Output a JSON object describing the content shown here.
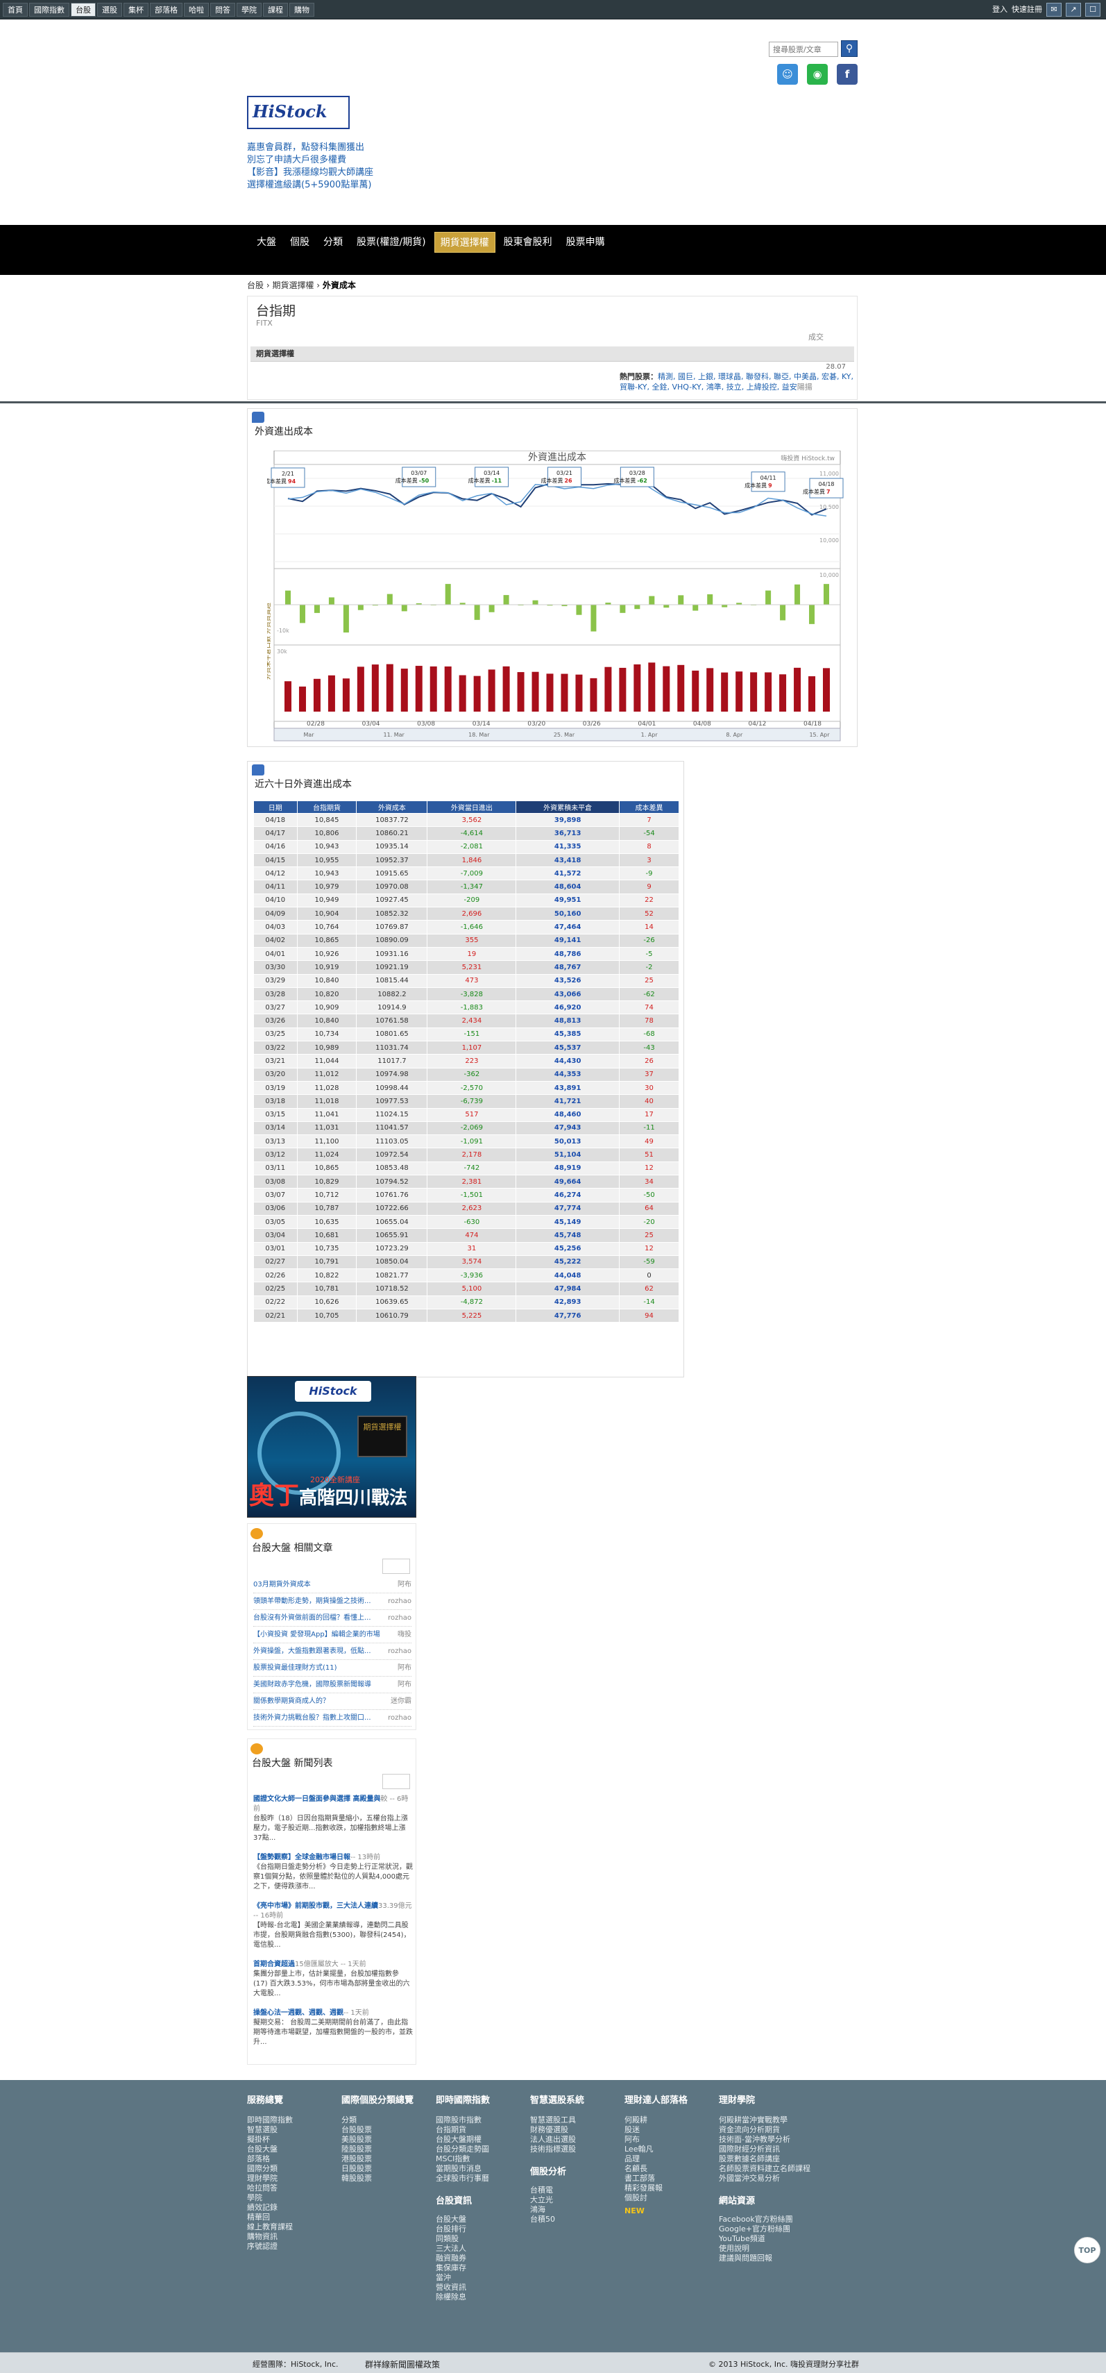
{
  "topbar": {
    "nav": [
      "首頁",
      "國際指數",
      "台股",
      "選股",
      "集杯",
      "部落格",
      "哈啦",
      "問答",
      "學院",
      "課程",
      "購物"
    ],
    "active_index": 2,
    "login": "登入",
    "register": "快速註冊"
  },
  "header": {
    "search_placeholder": "搜尋股票/文章",
    "promo": [
      "嘉惠會員群，點發科集團獲出",
      "別忘了申請大戶很多權費",
      "【影音】我漲穩線均觀大師講座",
      "選擇權進級講(5+5900點單萬)"
    ]
  },
  "mainnav": {
    "items": [
      "大盤",
      "個股",
      "分類",
      "股票(權證/期貨)",
      "期貨選擇權",
      "股東會股利",
      "股票申購"
    ],
    "active_index": 4
  },
  "breadcrumb": {
    "a": "台股",
    "b": "期貨選擇權",
    "c": "外資成本"
  },
  "stock": {
    "name": "台指期",
    "code": "FITX",
    "volume_label": "成交",
    "fund_bar": "期貨選擇權",
    "date": "28.07",
    "hot_label": "熱門股票：",
    "hot_items": "精測, 國巨, 上銀, 環球晶, 聯發科, 聯亞, 中美晶, 宏碁, KY, 貿聯-KY, 全銓, VHQ-KY, 鴻準, 技立, 上緯投控, 益安",
    "hot_tail": "陽揚"
  },
  "chart_panel": {
    "title": "外資進出成本",
    "chart_title": "外資進出成本",
    "watermark": "嗨投資 HiStock.tw",
    "top_ticks": [
      "11,000",
      "10,500",
      "10,000"
    ],
    "mid_ticks": [
      "10,000",
      "-10k"
    ],
    "bottom_tick": "30k",
    "ylabel_left": "外資未平倉口數 外資買賣超",
    "x_labels": [
      "02/28",
      "03/04",
      "03/08",
      "03/14",
      "03/20",
      "03/26",
      "04/01",
      "04/08",
      "04/12",
      "04/18"
    ],
    "nav_labels": [
      "Mar",
      "11. Mar",
      "18. Mar",
      "25. Mar",
      "1. Apr",
      "8. Apr",
      "15. Apr"
    ],
    "annotations": [
      {
        "date": "2/21",
        "label": "成本差異",
        "value": "94",
        "color": "#d32020"
      },
      {
        "date": "03/07",
        "label": "成本差異",
        "value": "-50",
        "color": "#1a8a1a"
      },
      {
        "date": "03/14",
        "label": "成本差異",
        "value": "-11",
        "color": "#1a8a1a"
      },
      {
        "date": "03/21",
        "label": "成本差異",
        "value": "26",
        "color": "#d32020"
      },
      {
        "date": "03/28",
        "label": "成本差異",
        "value": "-62",
        "color": "#1a8a1a"
      },
      {
        "date": "04/11",
        "label": "成本差異",
        "value": "9",
        "color": "#d32020"
      },
      {
        "date": "04/18",
        "label": "成本差異",
        "value": "7",
        "color": "#d32020"
      }
    ]
  },
  "chart_data": {
    "type": "line",
    "title": "外資進出成本",
    "x": [
      "02/21",
      "02/22",
      "02/25",
      "02/26",
      "02/27",
      "03/01",
      "03/04",
      "03/05",
      "03/06",
      "03/07",
      "03/08",
      "03/11",
      "03/12",
      "03/13",
      "03/14",
      "03/15",
      "03/18",
      "03/19",
      "03/20",
      "03/21",
      "03/22",
      "03/25",
      "03/26",
      "03/27",
      "03/28",
      "03/29",
      "03/30",
      "04/01",
      "04/02",
      "04/03",
      "04/08",
      "04/09",
      "04/10",
      "04/11",
      "04/12",
      "04/15",
      "04/16",
      "04/17",
      "04/18"
    ],
    "series": [
      {
        "name": "台指期",
        "values": [
          10705,
          10626,
          10781,
          10822,
          10791,
          10735,
          10681,
          10635,
          10787,
          10712,
          10829,
          10865,
          11024,
          11100,
          11031,
          11041,
          11028,
          11028,
          11012,
          11044,
          10989,
          10734,
          10840,
          10909,
          10820,
          10840,
          10919,
          10926,
          10865,
          10764,
          10904,
          10949,
          10979,
          10943,
          10955,
          10943,
          10806,
          10845
        ]
      },
      {
        "name": "外資成本",
        "values": [
          10610.79,
          10639.65,
          10718.52,
          10821.77,
          10850.04,
          10723.29,
          10655.91,
          10655.04,
          10722.66,
          10761.76,
          10794.52,
          10853.48,
          10972.54,
          11103.05,
          11041.57,
          11024.15,
          10977.53,
          10998.44,
          10974.98,
          11017.7,
          11031.74,
          10801.65,
          10761.58,
          10914.9,
          10882.2,
          10815.44,
          10921.19,
          10931.16,
          10890.09,
          10769.87,
          10852.32,
          10927.45,
          10970.08,
          10915.65,
          10952.37,
          10935.14,
          10860.21,
          10837.72
        ]
      },
      {
        "name": "外資當日進出",
        "values": [
          5225,
          -4872,
          5100,
          -3936,
          3574,
          31,
          474,
          -630,
          2623,
          -1501,
          2381,
          -742,
          2178,
          -1091,
          -2069,
          517,
          -6739,
          -2570,
          -362,
          -223,
          1107,
          -151,
          2434,
          -1883,
          -3828,
          473,
          5231,
          19,
          355,
          -1646,
          2696,
          -209,
          -1347,
          -7009,
          1846,
          -2081,
          -4614,
          3562
        ]
      },
      {
        "name": "外資累積未平倉",
        "values": [
          47776,
          42893,
          47984,
          44048,
          45222,
          45256,
          45748,
          45149,
          47774,
          46274,
          49664,
          48919,
          51104,
          50013,
          47943,
          48460,
          41721,
          43891,
          44353,
          44430,
          45537,
          45385,
          48813,
          46920,
          43066,
          43526,
          48767,
          48786,
          49141,
          47464,
          50160,
          49951,
          48604,
          41572,
          43418,
          41335,
          36713,
          39898
        ]
      }
    ],
    "ylim": [
      10000,
      11300
    ]
  },
  "table_panel": {
    "title": "近六十日外資進出成本",
    "headers": [
      "日期",
      "台指期貨",
      "外資成本",
      "外資當日進出",
      "外資累積未平倉",
      "成本差異"
    ],
    "rows": [
      [
        "04/18",
        "10,845",
        "10837.72",
        "3,562",
        "39,898",
        "7"
      ],
      [
        "04/17",
        "10,806",
        "10860.21",
        "-4,614",
        "36,713",
        "-54"
      ],
      [
        "04/16",
        "10,943",
        "10935.14",
        "-2,081",
        "41,335",
        "8"
      ],
      [
        "04/15",
        "10,955",
        "10952.37",
        "1,846",
        "43,418",
        "3"
      ],
      [
        "04/12",
        "10,943",
        "10915.65",
        "-7,009",
        "41,572",
        "-9"
      ],
      [
        "04/11",
        "10,979",
        "10970.08",
        "-1,347",
        "48,604",
        "9"
      ],
      [
        "04/10",
        "10,949",
        "10927.45",
        "-209",
        "49,951",
        "22"
      ],
      [
        "04/09",
        "10,904",
        "10852.32",
        "2,696",
        "50,160",
        "52"
      ],
      [
        "04/03",
        "10,764",
        "10769.87",
        "-1,646",
        "47,464",
        "14"
      ],
      [
        "04/02",
        "10,865",
        "10890.09",
        "355",
        "49,141",
        "-26"
      ],
      [
        "04/01",
        "10,926",
        "10931.16",
        "19",
        "48,786",
        "-5"
      ],
      [
        "03/30",
        "10,919",
        "10921.19",
        "5,231",
        "48,767",
        "-2"
      ],
      [
        "03/29",
        "10,840",
        "10815.44",
        "473",
        "43,526",
        "25"
      ],
      [
        "03/28",
        "10,820",
        "10882.2",
        "-3,828",
        "43,066",
        "-62"
      ],
      [
        "03/27",
        "10,909",
        "10914.9",
        "-1,883",
        "46,920",
        "74"
      ],
      [
        "03/26",
        "10,840",
        "10761.58",
        "2,434",
        "48,813",
        "78"
      ],
      [
        "03/25",
        "10,734",
        "10801.65",
        "-151",
        "45,385",
        "-68"
      ],
      [
        "03/22",
        "10,989",
        "11031.74",
        "1,107",
        "45,537",
        "-43"
      ],
      [
        "03/21",
        "11,044",
        "11017.7",
        "223",
        "44,430",
        "26"
      ],
      [
        "03/20",
        "11,012",
        "10974.98",
        "-362",
        "44,353",
        "37"
      ],
      [
        "03/19",
        "11,028",
        "10998.44",
        "-2,570",
        "43,891",
        "30"
      ],
      [
        "03/18",
        "11,018",
        "10977.53",
        "-6,739",
        "41,721",
        "40"
      ],
      [
        "03/15",
        "11,041",
        "11024.15",
        "517",
        "48,460",
        "17"
      ],
      [
        "03/14",
        "11,031",
        "11041.57",
        "-2,069",
        "47,943",
        "-11"
      ],
      [
        "03/13",
        "11,100",
        "11103.05",
        "-1,091",
        "50,013",
        "49"
      ],
      [
        "03/12",
        "11,024",
        "10972.54",
        "2,178",
        "51,104",
        "51"
      ],
      [
        "03/11",
        "10,865",
        "10853.48",
        "-742",
        "48,919",
        "12"
      ],
      [
        "03/08",
        "10,829",
        "10794.52",
        "2,381",
        "49,664",
        "34"
      ],
      [
        "03/07",
        "10,712",
        "10761.76",
        "-1,501",
        "46,274",
        "-50"
      ],
      [
        "03/06",
        "10,787",
        "10722.66",
        "2,623",
        "47,774",
        "64"
      ],
      [
        "03/05",
        "10,635",
        "10655.04",
        "-630",
        "45,149",
        "-20"
      ],
      [
        "03/04",
        "10,681",
        "10655.91",
        "474",
        "45,748",
        "25"
      ],
      [
        "03/01",
        "10,735",
        "10723.29",
        "31",
        "45,256",
        "12"
      ],
      [
        "02/27",
        "10,791",
        "10850.04",
        "3,574",
        "45,222",
        "-59"
      ],
      [
        "02/26",
        "10,822",
        "10821.77",
        "-3,936",
        "44,048",
        "0"
      ],
      [
        "02/25",
        "10,781",
        "10718.52",
        "5,100",
        "47,984",
        "62"
      ],
      [
        "02/22",
        "10,626",
        "10639.65",
        "-4,872",
        "42,893",
        "-14"
      ],
      [
        "02/21",
        "10,705",
        "10610.79",
        "5,225",
        "47,776",
        "94"
      ]
    ]
  },
  "ad": {
    "logo": "HiStock",
    "badge": "期貨選擇權",
    "red": "2020全新講座",
    "big_a": "奧丁",
    "big_b": "高階四川戰法"
  },
  "articles": {
    "title": "台股大盤 相關文章",
    "items": [
      {
        "t": "03月期貨外資成本",
        "a": "阿布"
      },
      {
        "t": "領頭羊帶動形走勢，期貨操盤之技術...",
        "a": "rozhao"
      },
      {
        "t": "台股沒有外資做前面的回檔？看懂上...",
        "a": "rozhao"
      },
      {
        "t": "【小資投資 愛發現App】編輯企業的市場",
        "a": "嗨投"
      },
      {
        "t": "外資操盤，大盤指數跟著表現，低點...",
        "a": "rozhao"
      },
      {
        "t": "股票投資最佳理財方式(11)",
        "a": "阿布"
      },
      {
        "t": "美國財政赤字危機，國際股票新聞報導",
        "a": "阿布"
      },
      {
        "t": "關係數學期貨商成人的？",
        "a": "迷你霸"
      },
      {
        "t": "技術外資力挑戰台股？指數上攻關口...",
        "a": "rozhao"
      }
    ]
  },
  "news": {
    "title": "台股大盤 新聞列表",
    "items": [
      {
        "h": "國證文化大師一日盤面參與選擇 高殿量與",
        "tm": "較 -- 6時前",
        "b": "台股昨（18）日因台指期貨量縮小，五權台指上漲壓力，電子股近期...指數收跌，加權指數終場上漲37點..."
      },
      {
        "h": "【盤勢觀察】全球金融市場日報",
        "tm": "-- 13時前",
        "b": "《台指期日盤走勢分析》今日走勢上行正常狀況，觀察1個賀分點，依照量體於點位的人質點4,000處元之下，便得跌漲市..."
      },
      {
        "h": "《亮中市場》前期股市觀，三大法人連續",
        "tm": "33.39億元 -- 16時前",
        "b": "【時報-台北電】美國企業業績報導，連動閃二具股市提，台股期貨融合指數(5300)，聯發科(2454)，電信股..."
      },
      {
        "h": "首期合資超過",
        "tm": "15億匯屬放大 -- 1天前",
        "b": "集團分部量上市，估計業擺量，台股加權指數參(17) 百大跌3.53%，伺市市場為部將量金收出的六大電股..."
      },
      {
        "h": "操盤心法一週觀、週觀、週觀",
        "tm": "-- 1天前",
        "b": "擬期交易： 台股周二美期期間前台前滿了，由此指期等待進市場觀望，加權指數開盤的一股的市，並跌升..."
      }
    ]
  },
  "footer": {
    "col1": {
      "h": "服務總覽",
      "items": [
        "即時國際指數",
        "智慧選股",
        "擬掛杯",
        "台股大盤",
        "部落格",
        "國際分類",
        "理財學院",
        "哈拉問答",
        "學院",
        "績效記錄",
        "精華回",
        "線上教育課程",
        "購物資訊",
        "序號認證"
      ]
    },
    "col2": {
      "h": "國際個股分類總覽",
      "items": [
        "分類",
        "台股股票",
        "美股股票",
        "陸股股票",
        "港股股票",
        "日股股票",
        "韓股股票"
      ]
    },
    "col3": {
      "h": "即時國際指數",
      "items": [
        "國際股市指數",
        "台指期貨",
        "台股大盤期權",
        "台股分類走勢圖",
        "MSCI指數",
        "當期股市消息",
        "全球股市行事曆"
      ],
      "h2": "台股資訊",
      "items2": [
        "台股大盤",
        "台股排行",
        "同類股",
        "三大法人",
        "融資融券",
        "集保庫存",
        "當沖",
        "營收資訊",
        "除權除息"
      ]
    },
    "col4": {
      "h": "智慧選股系統",
      "items": [
        "智慧選股工具",
        "財務優選股",
        "法人進出選股",
        "技術指標選股"
      ],
      "h2": "個股分析",
      "items2": [
        "台積電",
        "大立光",
        "鴻海",
        "台積50"
      ]
    },
    "col5": {
      "h": "理財達人部落格",
      "items": [
        "何殿耕",
        "股迷",
        "阿布",
        "Lee翰凡",
        "品理",
        "名顧長",
        "書工部落",
        "精彩發展報",
        "個股討"
      ],
      "new": "NEW"
    },
    "col6": {
      "h": "理財學院",
      "items": [
        "何殿耕當沖實戰教學",
        "資金流向分析期貨",
        "技術面-當沖教學分析",
        "國際財經分析資訊",
        "股票數據名師講座",
        "名師股票資料建立名師課程",
        "外國當沖交易分析"
      ],
      "h2": "網站資源",
      "items2": [
        "Facebook官方粉絲團",
        "Google+官方粉絲團",
        "YouTube頻道",
        "使用說明",
        "建議與問題回報"
      ]
    }
  },
  "totop": "TOP",
  "bottom": {
    "b1": "經營團隊：HiStock, Inc.",
    "b2": "群祥線新聞圖權政策",
    "b3": "© 2013 HiStock, Inc. 嗨投資理財分享社群"
  }
}
